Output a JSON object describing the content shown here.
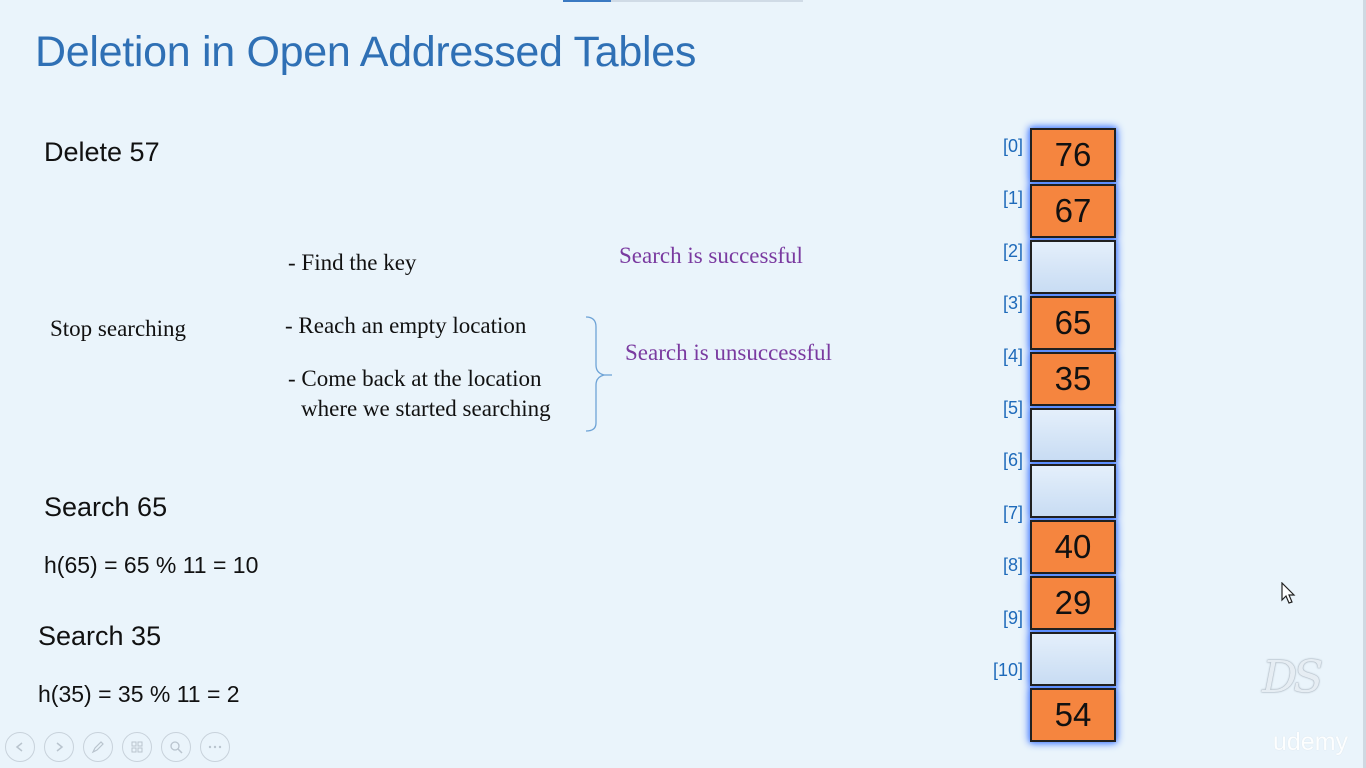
{
  "slide": {
    "title": "Deletion in Open Addressed Tables",
    "delete_heading": "Delete 57",
    "stop_label": "Stop searching",
    "conditions": {
      "find_key": "- Find the key",
      "empty_location": "- Reach an empty location",
      "come_back_line1": "- Come back at the location",
      "come_back_line2": "where we started searching"
    },
    "results": {
      "successful": "Search is successful",
      "unsuccessful": "Search is unsuccessful"
    },
    "search_65": {
      "heading": "Search 65",
      "formula": "h(65) = 65 % 11 = 10"
    },
    "search_35": {
      "heading": "Search 35",
      "formula": "h(35) = 35 % 11 = 2"
    }
  },
  "hash_table": {
    "slots": [
      {
        "index": "[0]",
        "value": "76"
      },
      {
        "index": "[1]",
        "value": "67"
      },
      {
        "index": "[2]",
        "value": ""
      },
      {
        "index": "[3]",
        "value": "65"
      },
      {
        "index": "[4]",
        "value": "35"
      },
      {
        "index": "[5]",
        "value": ""
      },
      {
        "index": "[6]",
        "value": ""
      },
      {
        "index": "[7]",
        "value": "40"
      },
      {
        "index": "[8]",
        "value": "29"
      },
      {
        "index": "[9]",
        "value": ""
      },
      {
        "index": "[10]",
        "value": "54"
      }
    ],
    "filled_color": "#f5853f",
    "empty_color": "#d4e4f6"
  },
  "branding": {
    "logo_text": "DS",
    "watermark": "udemy"
  },
  "controls": [
    {
      "icon": "previous-icon"
    },
    {
      "icon": "next-icon"
    },
    {
      "icon": "pen-icon"
    },
    {
      "icon": "slides-icon"
    },
    {
      "icon": "zoom-icon"
    },
    {
      "icon": "more-icon"
    }
  ],
  "colors": {
    "title": "#2f70b5",
    "index_label": "#1e6aba",
    "result_text": "#7a3aa0",
    "background": "#eaf4fb"
  }
}
